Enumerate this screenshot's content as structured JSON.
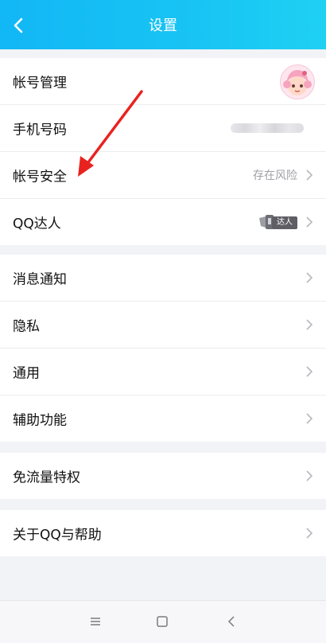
{
  "header": {
    "title": "设置"
  },
  "account": {
    "items": [
      {
        "label": "帐号管理",
        "right": ""
      },
      {
        "label": "手机号码",
        "right": ""
      },
      {
        "label": "帐号安全",
        "right": "存在风险"
      },
      {
        "label": "QQ达人",
        "right": ""
      }
    ],
    "daren_badge": "达人"
  },
  "settings": {
    "items": [
      {
        "label": "消息通知"
      },
      {
        "label": "隐私"
      },
      {
        "label": "通用"
      },
      {
        "label": "辅助功能"
      }
    ]
  },
  "data_plan": {
    "label": "免流量特权"
  },
  "about": {
    "label": "关于QQ与帮助"
  },
  "colors": {
    "header_start": "#12b7f5",
    "header_end": "#1fd1f3",
    "annotation_arrow": "#e8231f"
  },
  "icons": [
    "back-icon",
    "chevron-right-icon",
    "menu-icon",
    "home-icon",
    "back-nav-icon",
    "avatar-image"
  ]
}
